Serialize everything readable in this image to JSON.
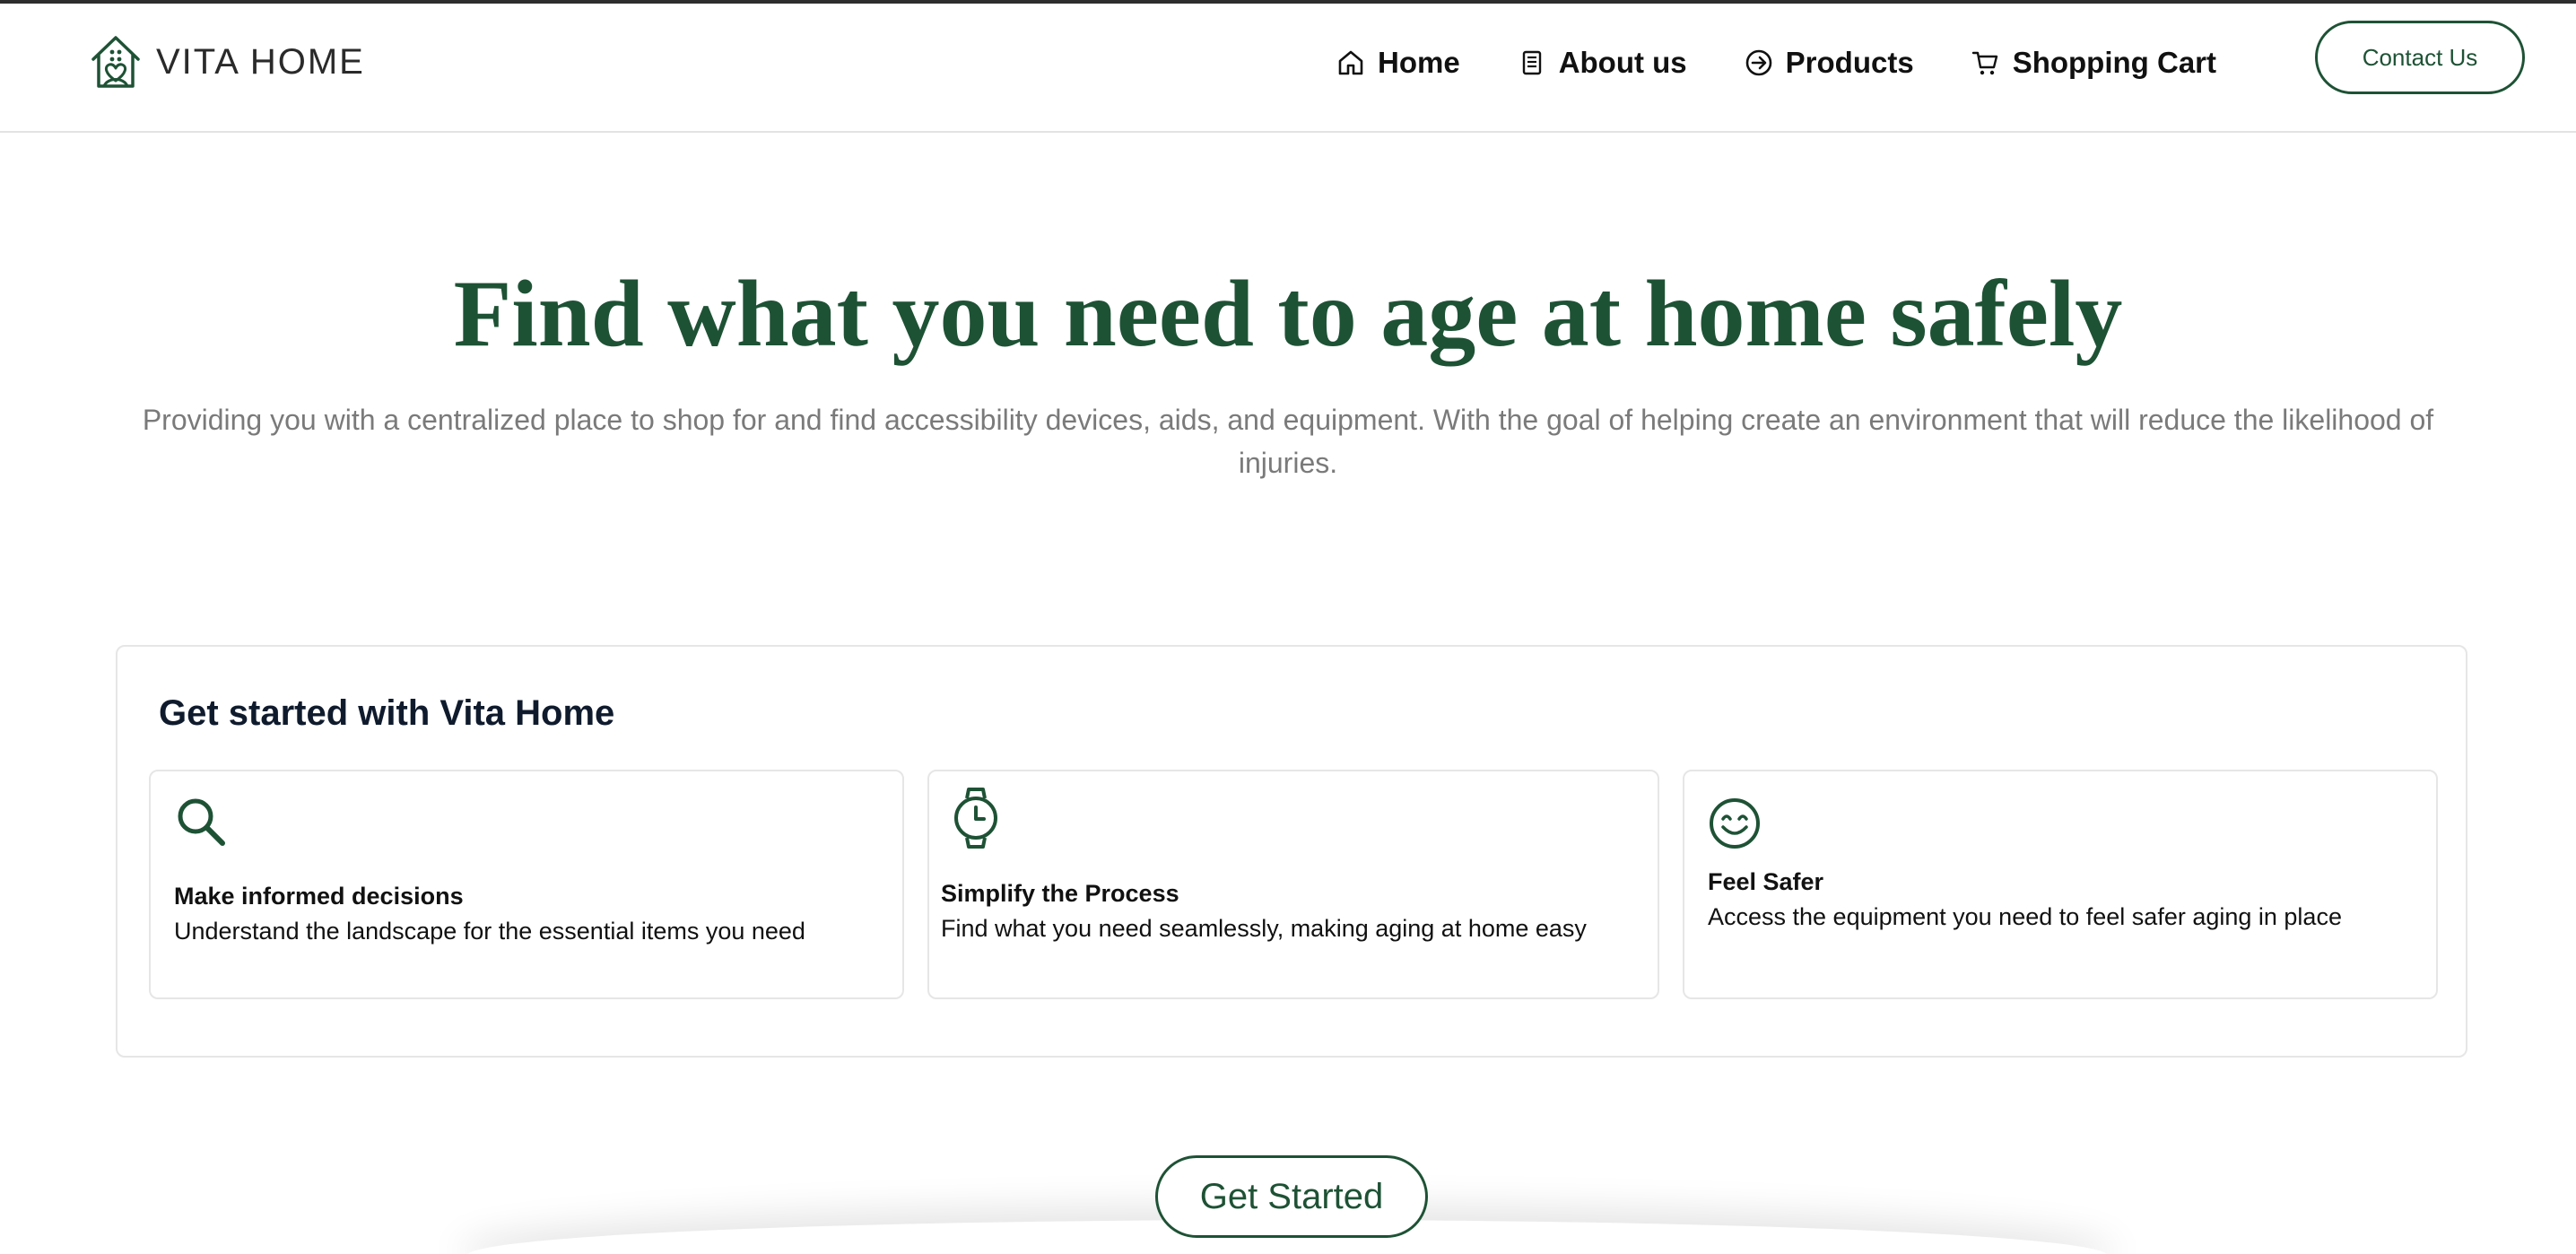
{
  "brand": {
    "name": "VITA HOME",
    "logo_icon": "house-heart-icon",
    "primary_color": "#1e5235"
  },
  "nav": {
    "items": [
      {
        "label": "Home",
        "icon": "home-icon"
      },
      {
        "label": "About us",
        "icon": "document-icon"
      },
      {
        "label": "Products",
        "icon": "arrow-circle-right-icon"
      },
      {
        "label": "Shopping Cart",
        "icon": "cart-icon"
      }
    ],
    "contact_label": "Contact Us"
  },
  "hero": {
    "title": "Find what you need to age at home safely",
    "subtitle": "Providing you with a centralized place to shop for and find accessibility devices, aids, and equipment. With the goal of helping create an environment that will reduce the likelihood of injuries."
  },
  "get_started": {
    "title": "Get started with Vita Home",
    "features": [
      {
        "icon": "search-icon",
        "title": "Make informed decisions",
        "description": "Understand the landscape for the essential items you need"
      },
      {
        "icon": "watch-icon",
        "title": "Simplify the Process",
        "description": "Find what you need seamlessly, making aging at home easy"
      },
      {
        "icon": "smile-icon",
        "title": "Feel Safer",
        "description": "Access the equipment you need to feel safer aging in place"
      }
    ]
  },
  "cta": {
    "label": "Get Started"
  }
}
